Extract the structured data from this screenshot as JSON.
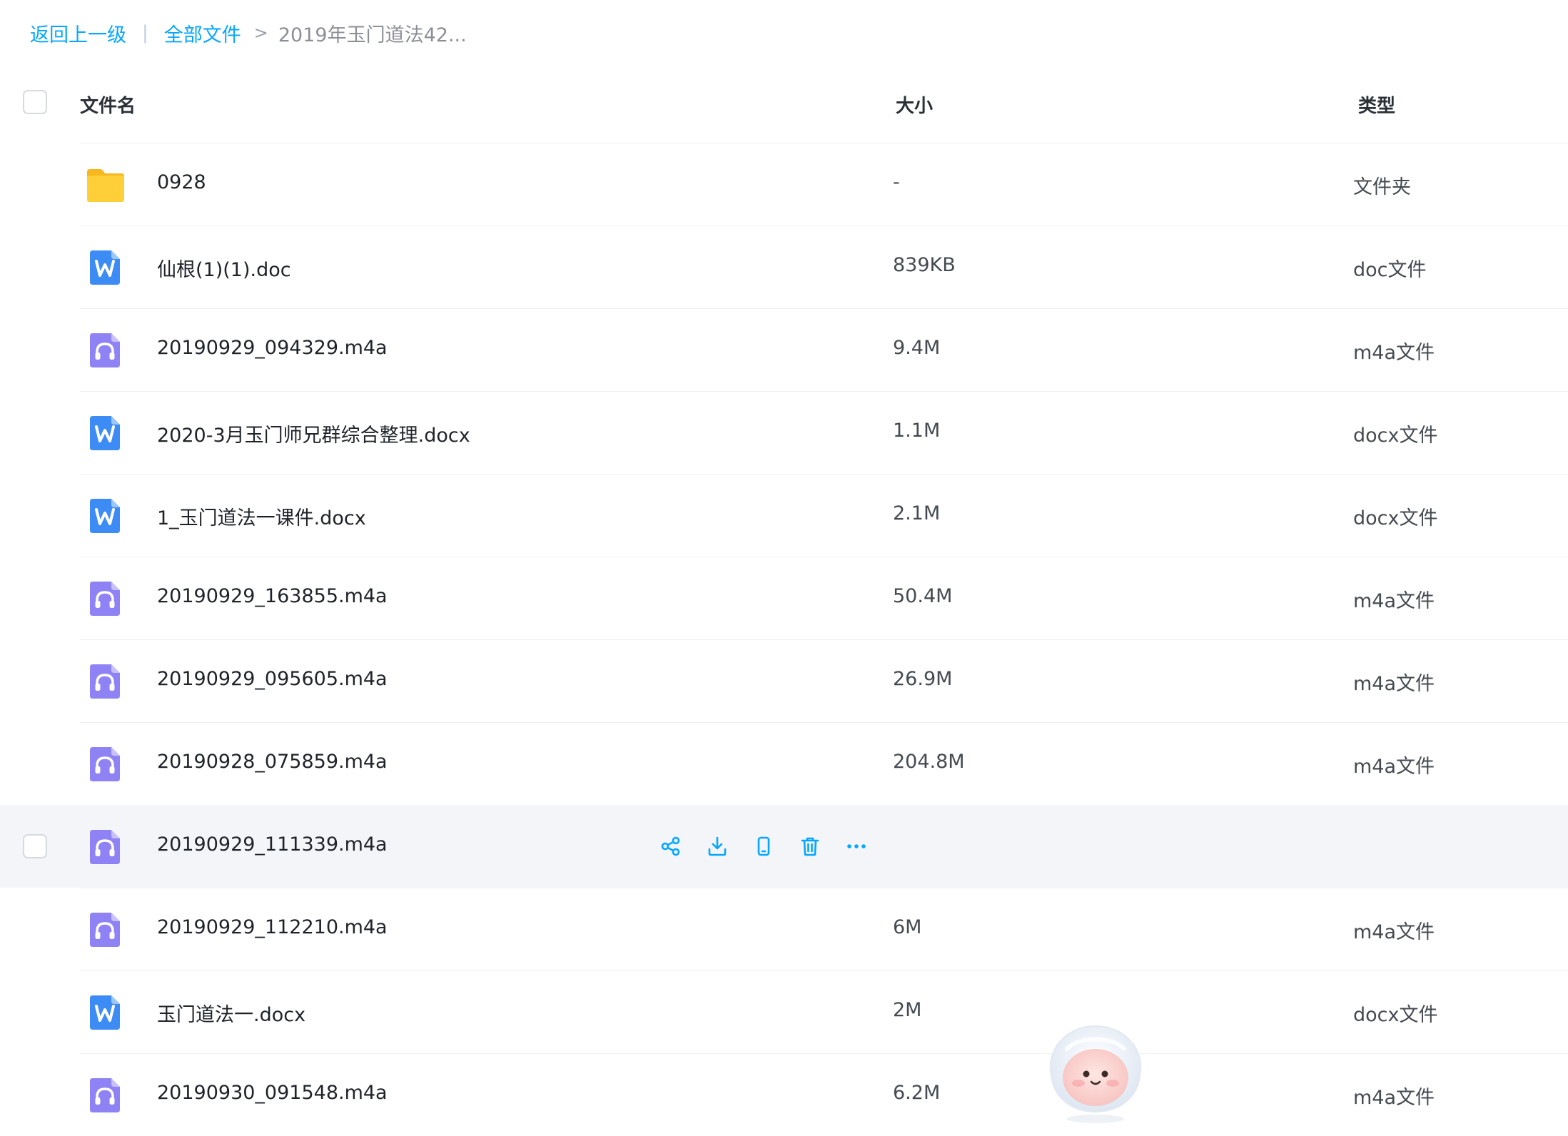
{
  "breadcrumb": {
    "back": "返回上一级",
    "separator": "|",
    "all_files": "全部文件",
    "arrow": ">",
    "current": "2019年玉门道法42..."
  },
  "columns": {
    "name": "文件名",
    "size": "大小",
    "type": "类型"
  },
  "colors": {
    "accent": "#06a7ff",
    "folder": "#ffc93d",
    "word": "#3d8bf5",
    "audio": "#8f82f5",
    "hover_row": "#f3f5f9"
  },
  "files": [
    {
      "icon": "folder-icon",
      "name": "0928",
      "size": "-",
      "type": "文件夹"
    },
    {
      "icon": "word-doc-icon",
      "name": "仙根(1)(1).doc",
      "size": "839KB",
      "type": "doc文件"
    },
    {
      "icon": "audio-file-icon",
      "name": "20190929_094329.m4a",
      "size": "9.4M",
      "type": "m4a文件"
    },
    {
      "icon": "word-doc-icon",
      "name": "2020-3月玉门师兄群综合整理.docx",
      "size": "1.1M",
      "type": "docx文件"
    },
    {
      "icon": "word-doc-icon",
      "name": "1_玉门道法一课件.docx",
      "size": "2.1M",
      "type": "docx文件"
    },
    {
      "icon": "audio-file-icon",
      "name": "20190929_163855.m4a",
      "size": "50.4M",
      "type": "m4a文件"
    },
    {
      "icon": "audio-file-icon",
      "name": "20190929_095605.m4a",
      "size": "26.9M",
      "type": "m4a文件"
    },
    {
      "icon": "audio-file-icon",
      "name": "20190928_075859.m4a",
      "size": "204.8M",
      "type": "m4a文件"
    },
    {
      "icon": "audio-file-icon",
      "name": "20190929_111339.m4a",
      "size": "",
      "type": "",
      "hovered": true
    },
    {
      "icon": "audio-file-icon",
      "name": "20190929_112210.m4a",
      "size": "6M",
      "type": "m4a文件"
    },
    {
      "icon": "word-doc-icon",
      "name": "玉门道法一.docx",
      "size": "2M",
      "type": "docx文件"
    },
    {
      "icon": "audio-file-icon",
      "name": "20190930_091548.m4a",
      "size": "6.2M",
      "type": "m4a文件"
    }
  ],
  "row_actions": [
    "share-icon",
    "download-icon",
    "phone-icon",
    "trash-icon",
    "more-icon"
  ]
}
